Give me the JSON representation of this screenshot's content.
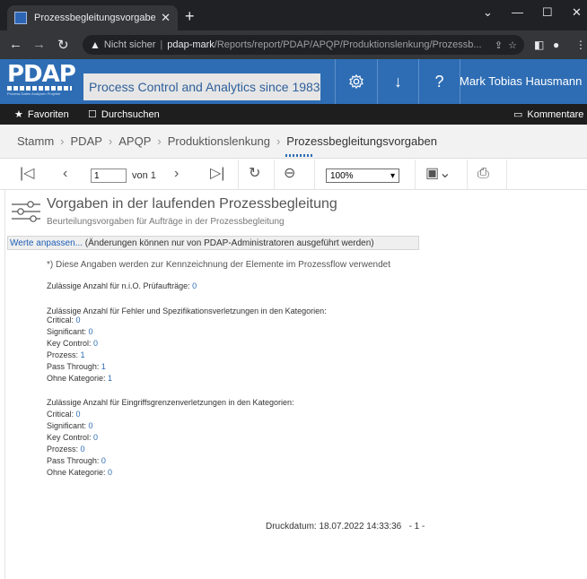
{
  "browser": {
    "tab_title": "Prozessbegleitungsvorgaben - St",
    "tab_close": "✕",
    "new_tab": "+",
    "controls": [
      "⌄",
      "—",
      "☐",
      "✕"
    ],
    "insecure_label": "Nicht sicher",
    "url_host": "pdap-mark",
    "url_path": "/Reports/report/PDAP/APQP/Produktionslenkung/Prozessb...",
    "icons": [
      "back-icon",
      "forward-icon",
      "reload-icon",
      "warning-icon",
      "share-icon",
      "star-icon",
      "sidepanel-icon",
      "extension-icon",
      "menu-icon"
    ]
  },
  "app": {
    "logo_text": "PDAP",
    "logo_subtitle": "Prozess Daten Analysen Projekte",
    "slogan": "Process Control and Analytics since 1983",
    "user": "Mark Tobias Hausmann",
    "help_label": "?",
    "brand_color": "#2e6db4"
  },
  "menubar": {
    "favorites": "Favoriten",
    "browse": "Durchsuchen",
    "comments": "Kommentare"
  },
  "breadcrumb": [
    "Stamm",
    "PDAP",
    "APQP",
    "Produktionslenkung",
    "Prozessbegleitungsvorgaben"
  ],
  "toolbar": {
    "page_value": "1",
    "page_of": "von 1",
    "zoom": "100%",
    "icons": [
      "first-page-icon",
      "prev-page-icon",
      "next-page-icon",
      "last-page-icon",
      "refresh-icon",
      "back-to-parent-icon",
      "save-icon",
      "print-icon"
    ]
  },
  "report": {
    "title": "Vorgaben in der laufenden Prozessbegleitung",
    "subtitle": "Beurteilungsvorgaben für Aufträge in der Prozessbegleitung",
    "hint_link": "Werte anpassen...",
    "hint_text": " (Änderungen können nur von PDAP-Administratoren ausgeführt werden)",
    "note": "*) Diese Angaben werden zur Kennzeichnung der Elemente im Prozessflow verwendet",
    "nio_label": "Zulässige Anzahl für n.i.O. Prüfaufträge: ",
    "nio_value": "0",
    "section1_title": "Zulässige Anzahl für Fehler und Spezifikationsverletzungen in den Kategorien:",
    "section1": [
      {
        "label": "Critical: ",
        "value": "0"
      },
      {
        "label": "Significant: ",
        "value": "0"
      },
      {
        "label": "Key Control: ",
        "value": "0"
      },
      {
        "label": "Prozess: ",
        "value": "1"
      },
      {
        "label": "Pass Through: ",
        "value": "1"
      },
      {
        "label": "Ohne Kategorie: ",
        "value": "1"
      }
    ],
    "section2_title": "Zulässige Anzahl für Eingriffsgrenzenverletzungen in den Kategorien:",
    "section2": [
      {
        "label": "Critical: ",
        "value": "0"
      },
      {
        "label": "Significant: ",
        "value": "0"
      },
      {
        "label": "Key Control: ",
        "value": "0"
      },
      {
        "label": "Prozess: ",
        "value": "0"
      },
      {
        "label": "Pass Through: ",
        "value": "0"
      },
      {
        "label": "Ohne Kategorie: ",
        "value": "0"
      }
    ],
    "print_date": "Druckdatum: 18.07.2022 14:33:36",
    "page_marker": "- 1 -"
  }
}
